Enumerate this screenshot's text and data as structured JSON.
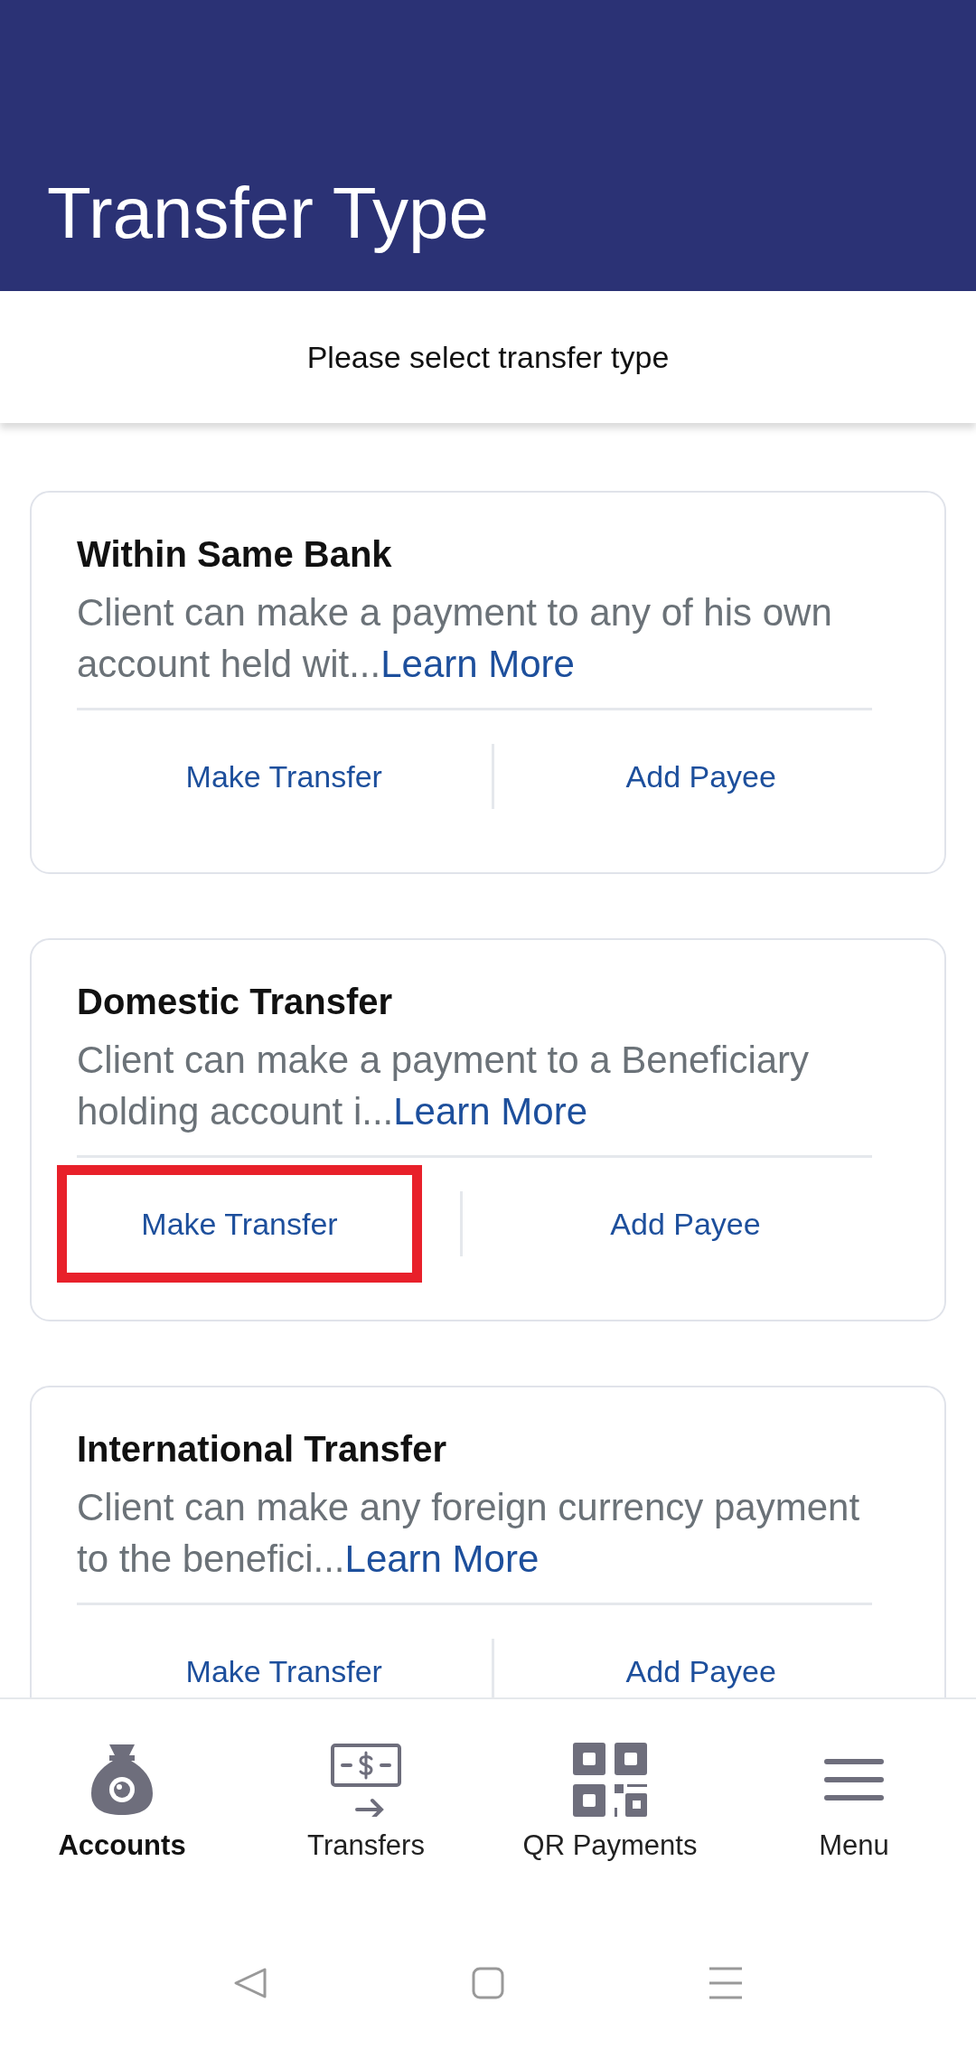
{
  "header": {
    "title": "Transfer Type"
  },
  "subtitle": "Please select transfer type",
  "cards": [
    {
      "title": "Within Same Bank",
      "description": "Client can make a payment to any of his own account held wit...",
      "link": "Learn More",
      "buttons": [
        {
          "label": "Make Transfer",
          "highlighted": false
        },
        {
          "label": "Add Payee",
          "highlighted": false
        }
      ]
    },
    {
      "title": "Domestic Transfer",
      "description": "Client can make a payment to a Beneficiary holding account i...",
      "link": "Learn More",
      "buttons": [
        {
          "label": "Make Transfer",
          "highlighted": true
        },
        {
          "label": "Add Payee",
          "highlighted": false
        }
      ]
    },
    {
      "title": "International Transfer",
      "description": "Client can make any foreign currency payment to the benefici...",
      "link": "Learn More",
      "buttons": [
        {
          "label": "Make Transfer",
          "highlighted": false
        },
        {
          "label": "Add Payee",
          "highlighted": false
        }
      ]
    }
  ],
  "bottom_nav": [
    {
      "label": "Accounts",
      "kind": "bag",
      "selected": true
    },
    {
      "label": "Transfers",
      "kind": "bill",
      "selected": false
    },
    {
      "label": "QR Payments",
      "kind": "qr",
      "selected": false
    },
    {
      "label": "Menu",
      "kind": "menu",
      "selected": false
    }
  ]
}
